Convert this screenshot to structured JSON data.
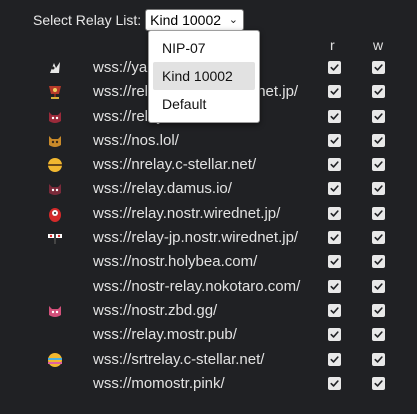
{
  "selector": {
    "label": "Select Relay List:",
    "selected": "Kind 10002",
    "options": [
      "NIP-07",
      "Kind 10002",
      "Default"
    ]
  },
  "columns": {
    "r": "r",
    "w": "w"
  },
  "relays": [
    {
      "url": "wss://yabu.me/",
      "icon": "yabu-icon",
      "r": true,
      "w": true
    },
    {
      "url": "wss://relay-jp.nostr.wirednet.jp/",
      "icon": "cup-icon",
      "r": true,
      "w": true
    },
    {
      "url": "wss://relay.nostr.band/",
      "icon": "red-cat-icon",
      "r": true,
      "w": true
    },
    {
      "url": "wss://nos.lol/",
      "icon": "orange-cat-icon",
      "r": true,
      "w": true
    },
    {
      "url": "wss://nrelay.c-stellar.net/",
      "icon": "yellow-orb-icon",
      "r": true,
      "w": true
    },
    {
      "url": "wss://relay.damus.io/",
      "icon": "damus-cat-icon",
      "r": true,
      "w": true
    },
    {
      "url": "wss://relay.nostr.wirednet.jp/",
      "icon": "daruma-icon",
      "r": true,
      "w": true
    },
    {
      "url": "wss://relay-jp.nostr.wirednet.jp/",
      "icon": "flag-icon",
      "r": true,
      "w": true
    },
    {
      "url": "wss://nostr.holybea.com/",
      "icon": "",
      "r": true,
      "w": true
    },
    {
      "url": "wss://nostr-relay.nokotaro.com/",
      "icon": "",
      "r": true,
      "w": true
    },
    {
      "url": "wss://nostr.zbd.gg/",
      "icon": "pink-cat-icon",
      "r": true,
      "w": true
    },
    {
      "url": "wss://relay.mostr.pub/",
      "icon": "",
      "r": true,
      "w": true
    },
    {
      "url": "wss://srtrelay.c-stellar.net/",
      "icon": "striped-orb-icon",
      "r": true,
      "w": true
    },
    {
      "url": "wss://momostr.pink/",
      "icon": "",
      "r": true,
      "w": true
    }
  ]
}
